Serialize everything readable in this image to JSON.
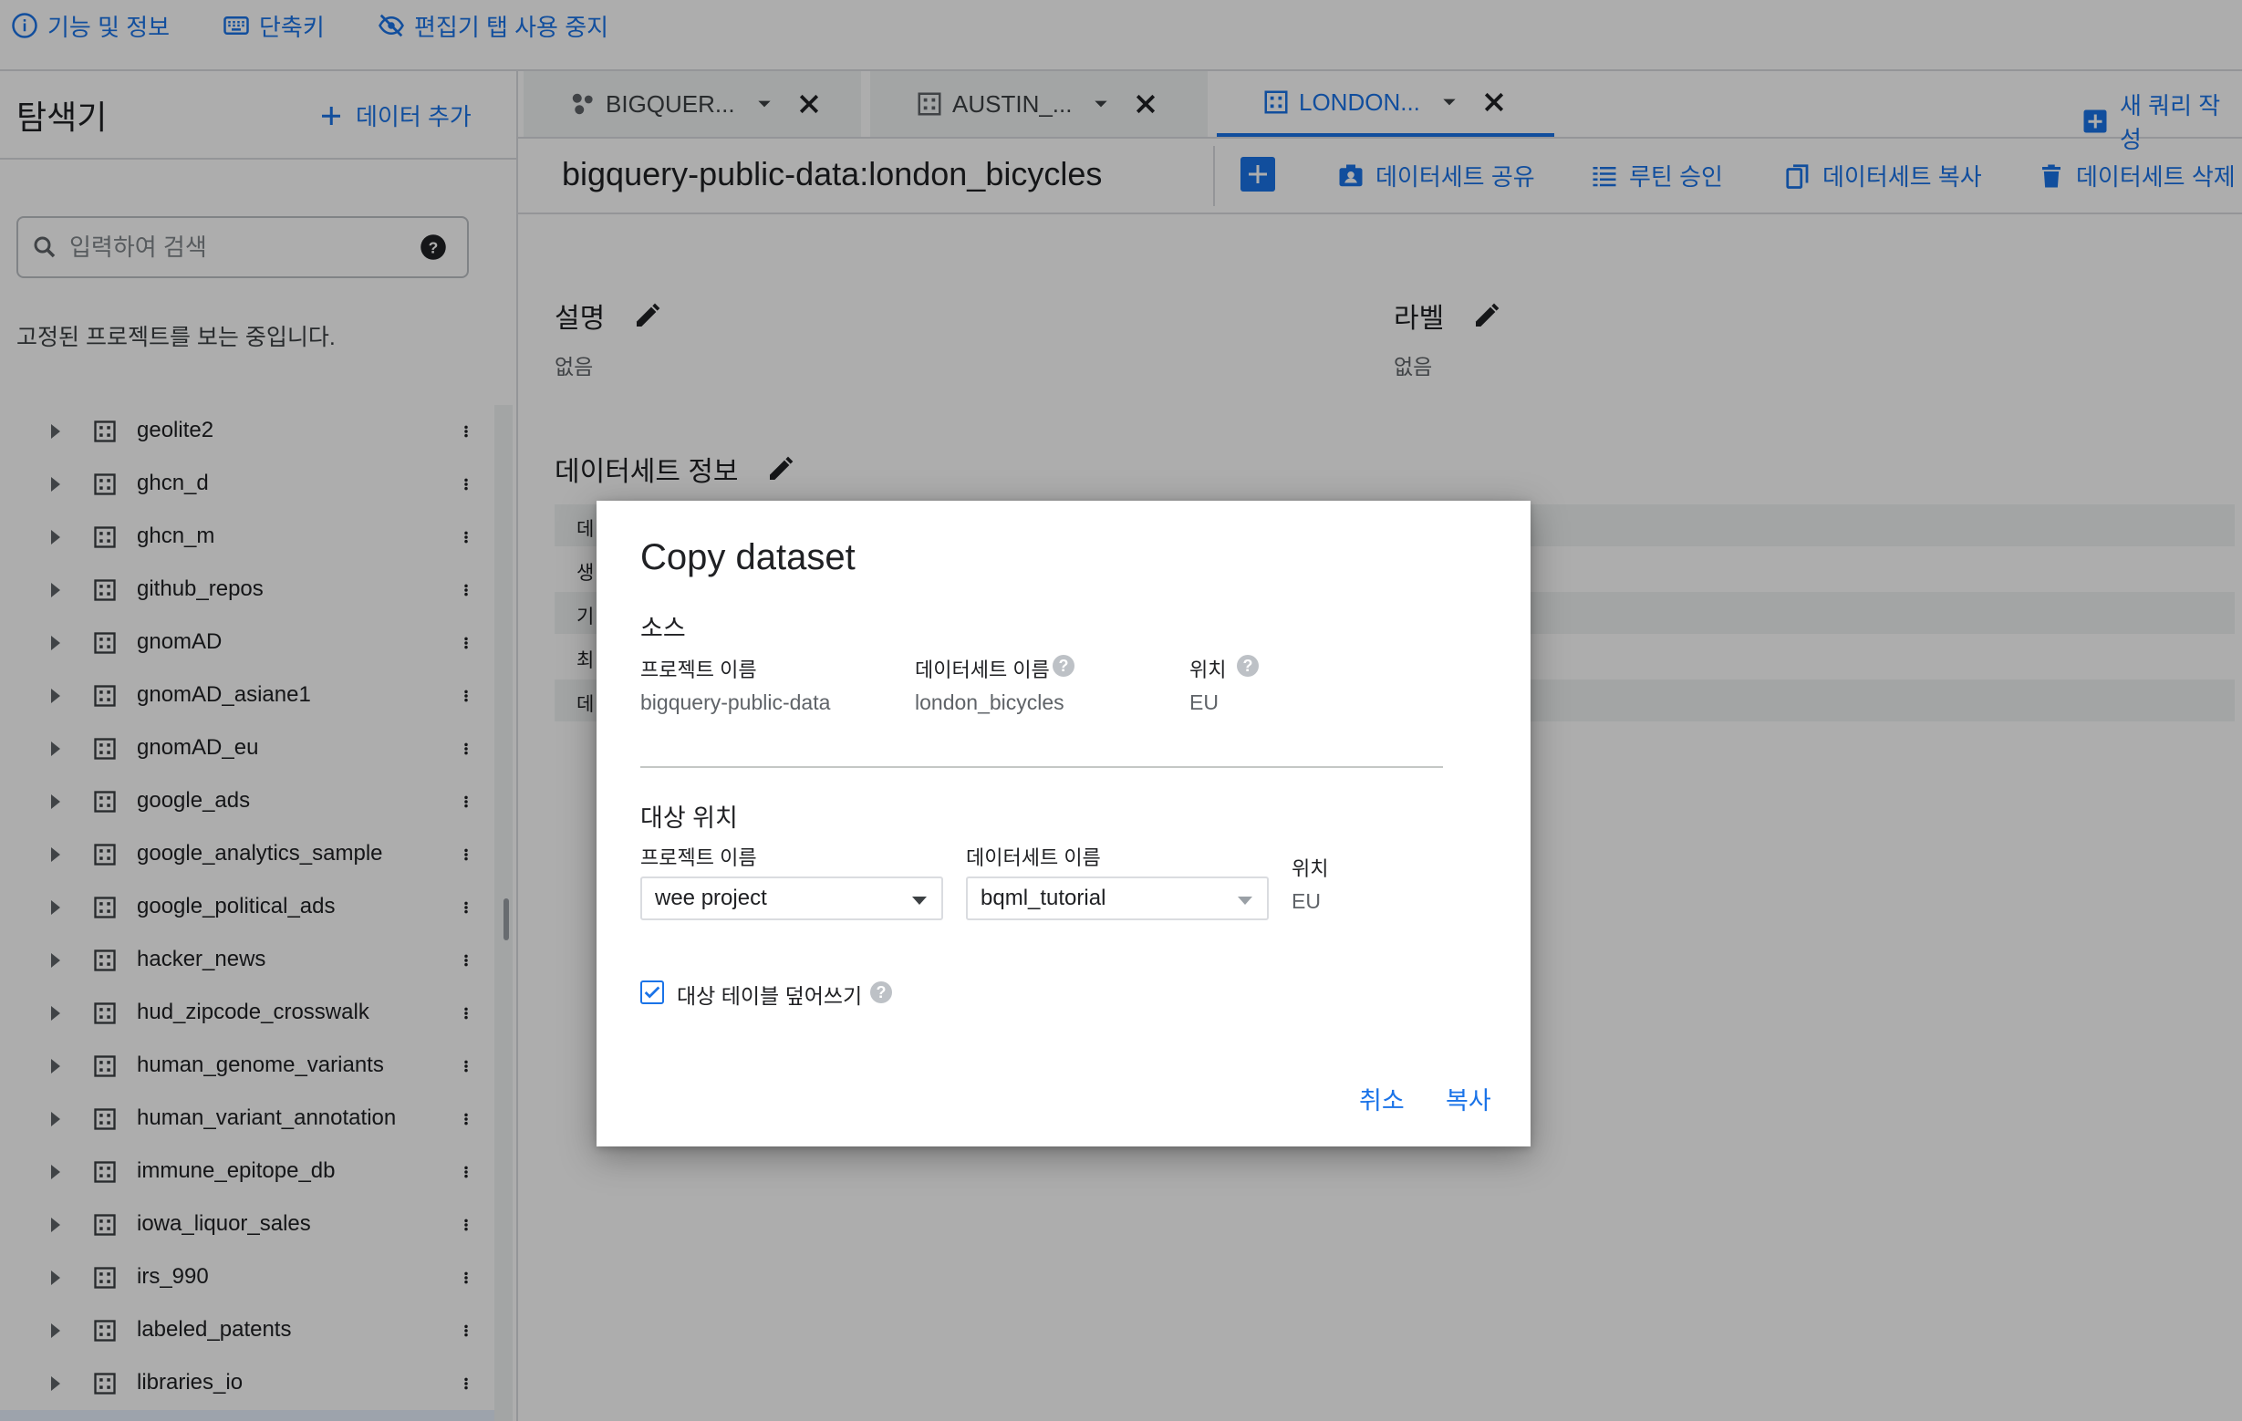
{
  "top_links": [
    {
      "label": "기능 및 정보",
      "icon": "info-icon"
    },
    {
      "label": "단축키",
      "icon": "keyboard-icon"
    },
    {
      "label": "편집기 탭 사용 중지",
      "icon": "visibility-off-icon"
    }
  ],
  "sidebar": {
    "title": "탐색기",
    "add_data_label": "데이터 추가",
    "search_placeholder": "입력하여 검색",
    "pinned_note": "고정된 프로젝트를 보는 중입니다.",
    "datasets": [
      "geolite2",
      "ghcn_d",
      "ghcn_m",
      "github_repos",
      "gnomAD",
      "gnomAD_asiane1",
      "gnomAD_eu",
      "google_ads",
      "google_analytics_sample",
      "google_political_ads",
      "hacker_news",
      "hud_zipcode_crosswalk",
      "human_genome_variants",
      "human_variant_annotation",
      "immune_epitope_db",
      "iowa_liquor_sales",
      "irs_990",
      "labeled_patents",
      "libraries_io"
    ]
  },
  "tabs": [
    {
      "label": "BIGQUER...",
      "icon": "query-icon",
      "active": false
    },
    {
      "label": "AUSTIN_...",
      "icon": "dataset-icon",
      "active": false
    },
    {
      "label": "LONDON...",
      "icon": "dataset-icon",
      "active": true
    }
  ],
  "new_query_label": "새 쿼리 작성",
  "dataset_header": {
    "title": "bigquery-public-data:london_bicycles",
    "actions": [
      {
        "label": "데이터세트 공유",
        "icon": "share-icon"
      },
      {
        "label": "루틴 승인",
        "icon": "list-icon"
      },
      {
        "label": "데이터세트 복사",
        "icon": "copy-icon"
      },
      {
        "label": "데이터세트 삭제",
        "icon": "delete-icon"
      }
    ]
  },
  "details": {
    "description_title": "설명",
    "description_value": "없음",
    "labels_title": "라벨",
    "labels_value": "없음",
    "info_title": "데이터세트 정보",
    "info_rows": [
      "데",
      "생",
      "기",
      "최",
      "데"
    ]
  },
  "dialog": {
    "title": "Copy dataset",
    "source_section": "소스",
    "source": {
      "project_label": "프로젝트 이름",
      "project_value": "bigquery-public-data",
      "dataset_label": "데이터세트 이름",
      "dataset_value": "london_bicycles",
      "location_label": "위치",
      "location_value": "EU"
    },
    "target_section": "대상 위치",
    "target": {
      "project_label": "프로젝트 이름",
      "project_value": "wee project",
      "dataset_label": "데이터세트 이름",
      "dataset_value": "bqml_tutorial",
      "location_label": "위치",
      "location_value": "EU"
    },
    "overwrite_label": "대상 테이블 덮어쓰기",
    "overwrite_checked": true,
    "cancel_label": "취소",
    "copy_label": "복사"
  },
  "colors": {
    "accent": "#1a73e8",
    "text": "#202124",
    "muted": "#5f6368",
    "divider": "#dadce0"
  }
}
